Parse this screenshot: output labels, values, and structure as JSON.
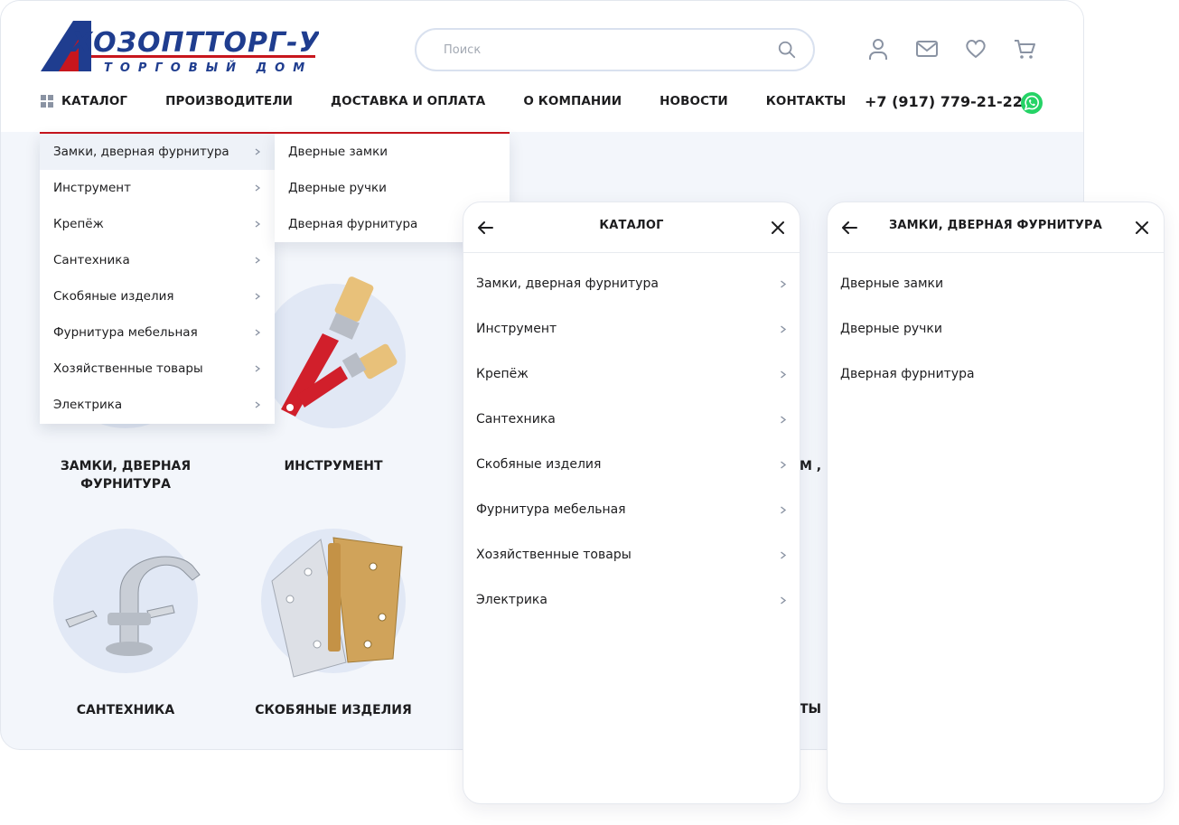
{
  "brand": {
    "logo_main": "ХОЗОПТТОРГ-УФА",
    "logo_sub": "ТОРГОВЫЙ ДОМ"
  },
  "search": {
    "placeholder": "Поиск"
  },
  "header_icons": [
    "user-icon",
    "mail-icon",
    "heart-icon",
    "cart-icon"
  ],
  "nav": {
    "items": [
      {
        "label": "КАТАЛОГ",
        "icon": "grid-icon"
      },
      {
        "label": "ПРОИЗВОДИТЕЛИ"
      },
      {
        "label": "ДОСТАВКА И ОПЛАТА"
      },
      {
        "label": "О КОМПАНИИ"
      },
      {
        "label": "НОВОСТИ"
      },
      {
        "label": "КОНТАКТЫ"
      }
    ],
    "phone": "+7 (917) 779-21-22",
    "whatsapp_icon": "whatsapp-icon"
  },
  "dropdown": {
    "categories": [
      "Замки, дверная фурнитура",
      "Инструмент",
      "Крепёж",
      "Сантехника",
      "Скобяные изделия",
      "Фурнитура мебельная",
      "Хозяйственные товары",
      "Электрика"
    ],
    "subcategories": [
      "Дверные замки",
      "Дверные ручки",
      "Дверная фурнитура"
    ]
  },
  "grid": {
    "cards": [
      {
        "label_line1": "ЗАМКИ, ДВЕРНАЯ",
        "label_line2": "ФУРНИТУРА"
      },
      {
        "label_line1": "ИНСТРУМЕНТ",
        "label_line2": ""
      },
      {
        "label_line1": "САНТЕХНИКА",
        "label_line2": ""
      },
      {
        "label_line1": "СКОБЯНЫЕ ИЗДЕЛИЯ",
        "label_line2": ""
      }
    ],
    "partial_text_1": "М ,",
    "partial_text_2": "ТЫ"
  },
  "mobile_catalog": {
    "title": "КАТАЛОГ",
    "items": [
      "Замки, дверная фурнитура",
      "Инструмент",
      "Крепёж",
      "Сантехника",
      "Скобяные изделия",
      "Фурнитура мебельная",
      "Хозяйственные товары",
      "Электрика"
    ]
  },
  "mobile_sub": {
    "title": "ЗАМКИ, ДВЕРНАЯ ФУРНИТУРА",
    "items": [
      "Дверные замки",
      "Дверные ручки",
      "Дверная фурнитура"
    ]
  },
  "colors": {
    "brand_blue": "#1f3d8f",
    "brand_red": "#c8161d",
    "whatsapp_green": "#25d366",
    "background": "#f3f6fb"
  }
}
